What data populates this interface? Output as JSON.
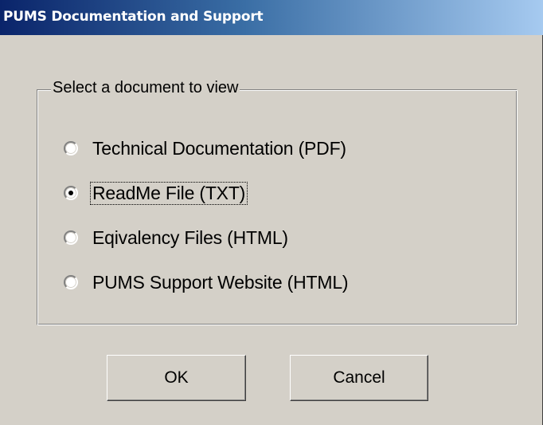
{
  "window": {
    "title": "PUMS Documentation and Support"
  },
  "group": {
    "legend": "Select a document to view"
  },
  "options": [
    {
      "label": "Technical Documentation (PDF)",
      "selected": false
    },
    {
      "label": "ReadMe File (TXT)",
      "selected": true
    },
    {
      "label": "Eqivalency Files (HTML)",
      "selected": false
    },
    {
      "label": "PUMS Support Website (HTML)",
      "selected": false
    }
  ],
  "buttons": {
    "ok_label": "OK",
    "cancel_label": "Cancel"
  },
  "colors": {
    "title_bar_start": "#0a246a",
    "title_bar_end": "#a6caf0",
    "dialog_face": "#d4d0c8"
  }
}
